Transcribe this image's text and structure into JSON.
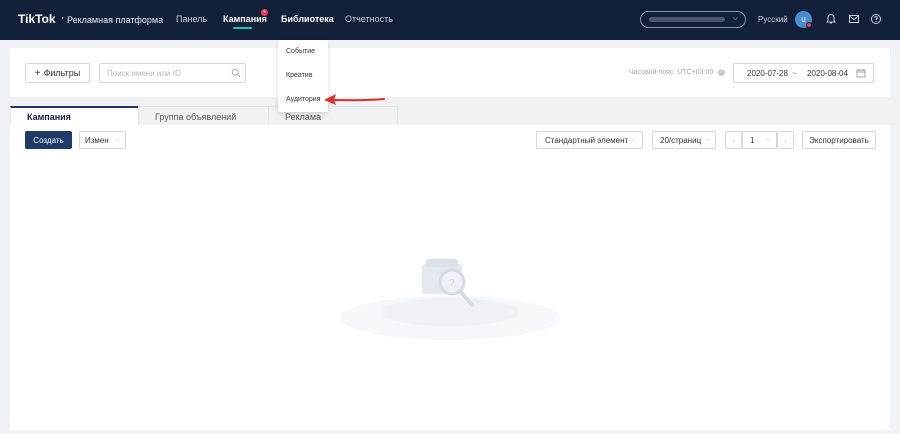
{
  "topbar": {
    "logo": "TikTok",
    "logo_suffix": "·",
    "platform": "Рекламная платформа",
    "nav": [
      {
        "label": "Панель"
      },
      {
        "label": "Кампания"
      },
      {
        "label": "Библиотека"
      },
      {
        "label": "Отчетность"
      }
    ],
    "campaign_badge": "+",
    "language": "Русский",
    "avatar_initial": "u"
  },
  "library_menu": {
    "items": [
      "Событие",
      "Креатив",
      "Аудитория"
    ]
  },
  "filters": {
    "filter_button": "Фильтры",
    "filter_icon": "+",
    "search_placeholder": "Поиск имени или ID",
    "timezone": "Часовой пояс: UTC+03:00",
    "date_start": "2020-07-28",
    "date_sep": "~",
    "date_end": "2020-08-04"
  },
  "tabs": [
    {
      "label": "Кампания"
    },
    {
      "label": "Группа объявлений"
    },
    {
      "label": "Реклама"
    }
  ],
  "toolbar": {
    "create": "Создать",
    "edit": "Измен",
    "view_select": "Стандартный элемент",
    "page_size": "20/страниц",
    "prev": "‹",
    "page": "1",
    "next": "›",
    "export": "Экспортировать"
  },
  "colors": {
    "topbar": "#13203a",
    "accent": "#25c4b8",
    "primary": "#1f3a66",
    "arrow": "#d9302c",
    "badge": "#e8395e"
  }
}
